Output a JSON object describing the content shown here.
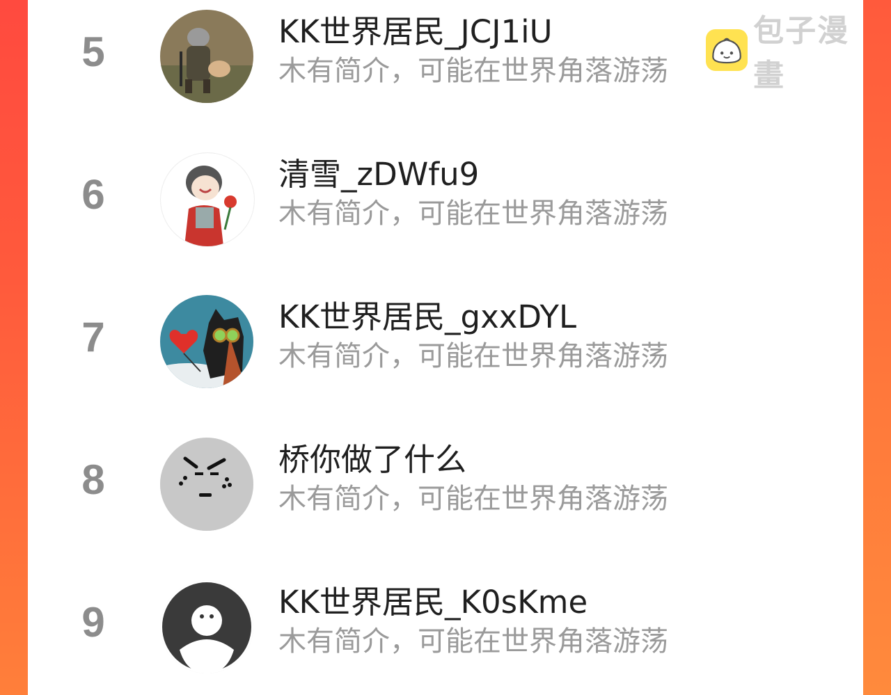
{
  "watermark": {
    "text": "包子漫畫",
    "icon": "bun-logo-icon"
  },
  "rows": [
    {
      "rank": "5",
      "name": "KK世界居民_JCJ1iU",
      "bio": "木有简介，可能在世界角落游荡",
      "avatar": "cat-with-gun-avatar"
    },
    {
      "rank": "6",
      "name": "清雪_zDWfu9",
      "bio": "木有简介，可能在世界角落游荡",
      "avatar": "anime-boy-flower-avatar"
    },
    {
      "rank": "7",
      "name": "KK世界居民_gxxDYL",
      "bio": "木有简介，可能在世界角落游荡",
      "avatar": "black-cat-heart-avatar"
    },
    {
      "rank": "8",
      "name": "桥你做了什么",
      "bio": "木有简介，可能在世界角落游荡",
      "avatar": "grey-face-avatar"
    },
    {
      "rank": "9",
      "name": "KK世界居民_K0sKme",
      "bio": "木有简介，可能在世界角落游荡",
      "avatar": "default-ghost-avatar"
    }
  ]
}
